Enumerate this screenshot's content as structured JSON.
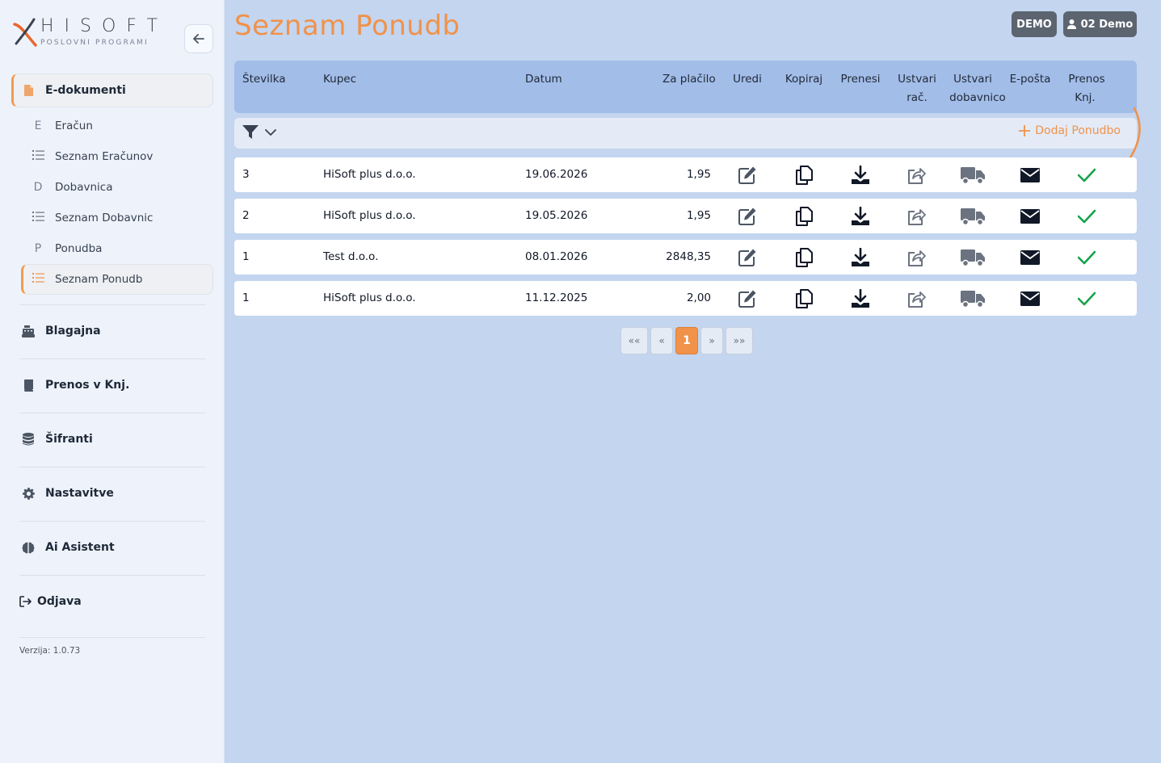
{
  "brand": {
    "name": "HISOFT",
    "tagline": "POSLOVNI PROGRAMI"
  },
  "sidebar": {
    "active_section": "E-dokumenti",
    "sub_items": [
      {
        "label": "Eračun",
        "icon_letter": "E"
      },
      {
        "label": "Seznam Eračunov",
        "icon": "list-icon"
      },
      {
        "label": "Dobavnica",
        "icon_letter": "D"
      },
      {
        "label": "Seznam Dobavnic",
        "icon": "list-icon"
      },
      {
        "label": "Ponudba",
        "icon_letter": "P"
      },
      {
        "label": "Seznam Ponudb",
        "icon": "list-icon"
      }
    ],
    "sections": [
      {
        "label": "Blagajna",
        "icon": "cash-register-icon"
      },
      {
        "label": "Prenos v Knj.",
        "icon": "book-icon"
      },
      {
        "label": "Šifranti",
        "icon": "database-icon"
      },
      {
        "label": "Nastavitve",
        "icon": "gear-icon"
      },
      {
        "label": "Ai Asistent",
        "icon": "brain-icon"
      },
      {
        "label": "Odjava",
        "icon": "logout-icon"
      }
    ],
    "version": "Verzija: 1.0.73"
  },
  "header": {
    "title": "Seznam Ponudb",
    "env_badge": "DEMO",
    "user": "02 Demo"
  },
  "table": {
    "columns": {
      "stevilka": "Številka",
      "kupec": "Kupec",
      "datum": "Datum",
      "za_placilo": "Za plačilo",
      "uredi": "Uredi",
      "kopiraj": "Kopiraj",
      "prenesi": "Prenesi",
      "ustvari_rac_1": "Ustvari",
      "ustvari_rac_2": "rač.",
      "ustvari_dob_1": "Ustvari",
      "ustvari_dob_2": "dobavnico",
      "eposta": "E-pošta",
      "prenos_1": "Prenos",
      "prenos_2": "Knj."
    },
    "add_label": "Dodaj Ponudbo",
    "rows": [
      {
        "stevilka": "3",
        "kupec": "HiSoft plus d.o.o.",
        "datum": "19.06.2026",
        "za_placilo": "1,95"
      },
      {
        "stevilka": "2",
        "kupec": "HiSoft plus d.o.o.",
        "datum": "19.05.2026",
        "za_placilo": "1,95"
      },
      {
        "stevilka": "1",
        "kupec": "Test d.o.o.",
        "datum": "08.01.2026",
        "za_placilo": "2848,35"
      },
      {
        "stevilka": "1",
        "kupec": "HiSoft plus d.o.o.",
        "datum": "11.12.2025",
        "za_placilo": "2,00"
      }
    ]
  },
  "pagination": {
    "first": "««",
    "prev": "«",
    "current": "1",
    "next": "»",
    "last": "»»"
  },
  "colors": {
    "accent": "#f0924a",
    "check": "#16a34a",
    "header_bg": "#a3bde9"
  }
}
